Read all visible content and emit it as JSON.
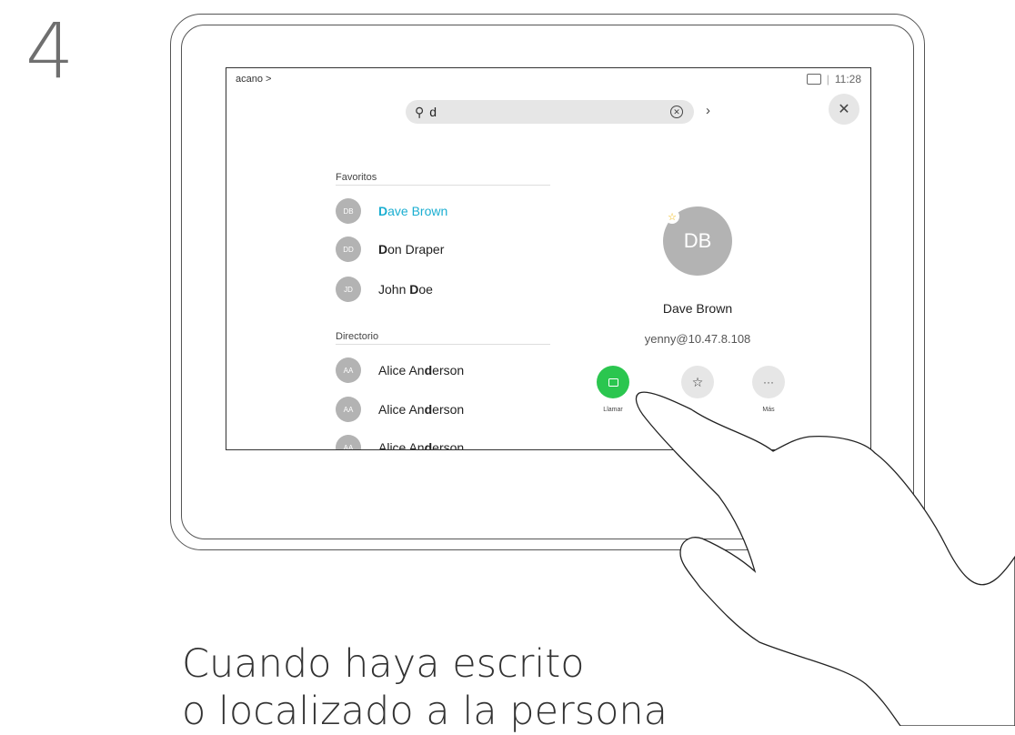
{
  "step": "4",
  "screen": {
    "breadcrumb": "acano >",
    "time": "11:28",
    "search": {
      "query": "d",
      "placeholder": ""
    },
    "sections": {
      "favorites_label": "Favoritos",
      "directory_label": "Directorio"
    },
    "favorites": [
      {
        "initials": "DB",
        "bold": "D",
        "rest": "ave Brown",
        "selected": true
      },
      {
        "initials": "DD",
        "bold": "D",
        "rest": "on Draper",
        "selected": false
      },
      {
        "initials": "JD",
        "pre": "John ",
        "bold": "D",
        "rest": "oe",
        "selected": false
      }
    ],
    "directory": [
      {
        "initials": "AA",
        "pre": "Alice An",
        "bold": "d",
        "rest": "erson"
      },
      {
        "initials": "AA",
        "pre": "Alice An",
        "bold": "d",
        "rest": "erson"
      },
      {
        "initials": "AA",
        "pre": "Alice An",
        "bold": "d",
        "rest": "erson"
      }
    ],
    "detail": {
      "initials": "DB",
      "name": "Dave Brown",
      "address": "yenny@10.47.8.108",
      "favorite_star": "☆"
    },
    "actions": {
      "call_label": "Llamar",
      "more_label": "Más",
      "more_glyph": "···",
      "fav_glyph": "☆"
    }
  },
  "caption": {
    "line1": "Cuando haya escrito",
    "line2": "o localizado a la persona"
  },
  "colors": {
    "accent": "#1aaed1",
    "call_green": "#2bc64f",
    "avatar_grey": "#b3b3b3",
    "star": "#f0b400"
  }
}
